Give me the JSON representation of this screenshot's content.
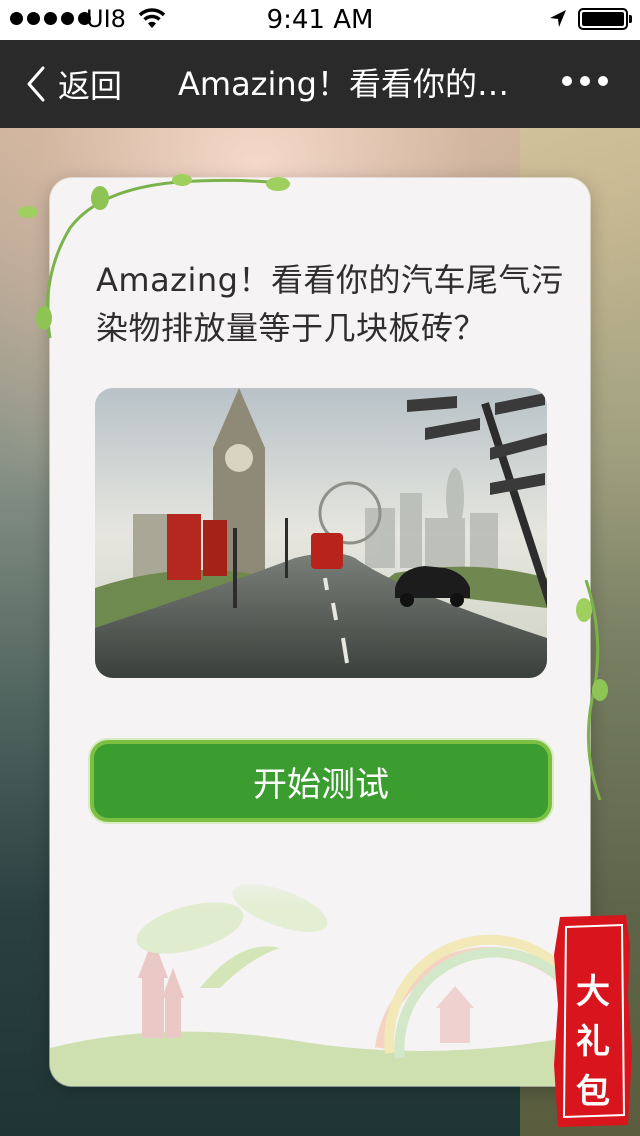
{
  "status_bar": {
    "carrier": "UI8",
    "time": "9:41 AM"
  },
  "nav": {
    "back_label": "返回",
    "title": "Amazing！看看你的汽..."
  },
  "card": {
    "headline": "Amazing！看看你的汽车尾气污染物排放量等于几块板砖？",
    "start_button": "开始测试"
  },
  "stamp": {
    "text": "大礼包"
  },
  "colors": {
    "nav_bg": "#2a2a2a",
    "button_green": "#3b9c2f",
    "stamp_red": "#d8141c"
  },
  "icons": [
    "signal-icon",
    "wifi-icon",
    "location-icon",
    "battery-icon",
    "back-chevron-icon",
    "more-icon"
  ]
}
